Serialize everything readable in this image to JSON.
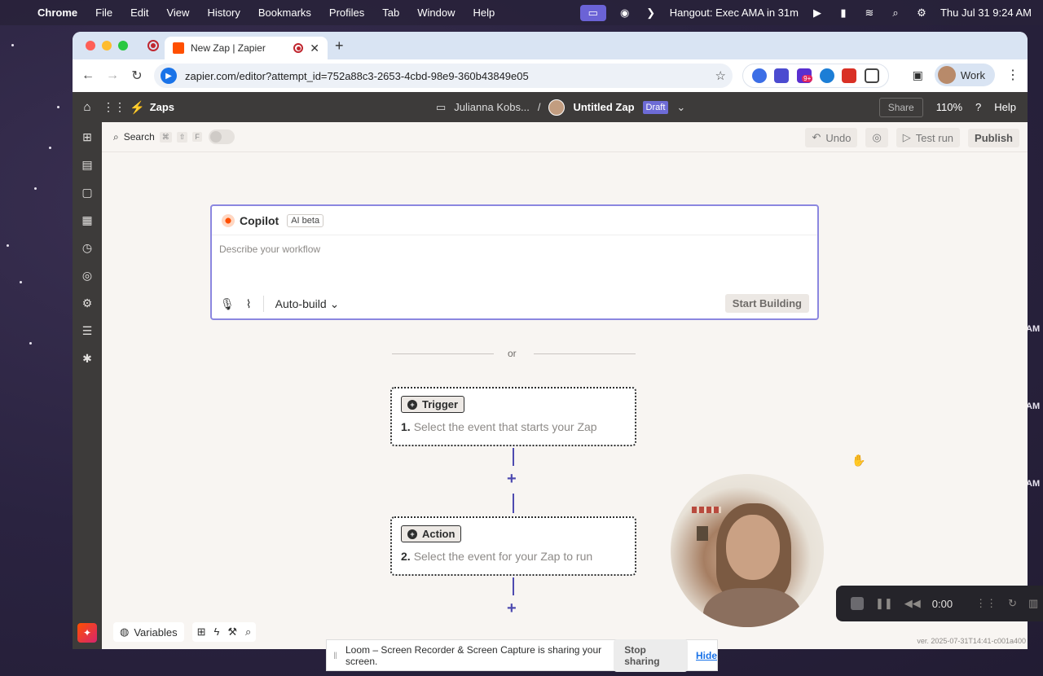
{
  "menubar": {
    "app": "Chrome",
    "items": [
      "File",
      "Edit",
      "View",
      "History",
      "Bookmarks",
      "Profiles",
      "Tab",
      "Window",
      "Help"
    ],
    "event": "Hangout: Exec AMA in 31m",
    "datetime": "Thu Jul 31  9:24 AM"
  },
  "desktop": {
    "side_labels": [
      "AM",
      "AM",
      "AM"
    ]
  },
  "browser": {
    "tab_title": "New Zap | Zapier",
    "url": "zapier.com/editor?attempt_id=752a88c3-2653-4cbd-98e9-360b43849e05",
    "profile": "Work",
    "ext_badge": "9+"
  },
  "zapier": {
    "brand": "Zaps",
    "folder": "Julianna Kobs...",
    "separator": "/",
    "zap_name": "Untitled Zap",
    "status": "Draft",
    "share": "Share",
    "zoom": "110%",
    "help": "Help"
  },
  "canvas_bar": {
    "search": "Search",
    "kbd1": "⌘",
    "kbd2": "⇧",
    "kbd3": "F",
    "undo": "Undo",
    "test_run": "Test run",
    "publish": "Publish"
  },
  "copilot": {
    "title": "Copilot",
    "badge": "AI beta",
    "placeholder": "Describe your workflow",
    "mode": "Auto-build",
    "start": "Start Building"
  },
  "divider": {
    "text": "or"
  },
  "steps": [
    {
      "type": "Trigger",
      "number": "1.",
      "description": "Select the event that starts your Zap"
    },
    {
      "type": "Action",
      "number": "2.",
      "description": "Select the event for your Zap to run"
    }
  ],
  "bottom_tools": {
    "variables": "Variables"
  },
  "version": "ver. 2025-07-31T14:41-c001a400",
  "loom": {
    "timer": "0:00",
    "share_msg": "Loom – Screen Recorder & Screen Capture is sharing your screen.",
    "stop": "Stop sharing",
    "hide": "Hide"
  }
}
